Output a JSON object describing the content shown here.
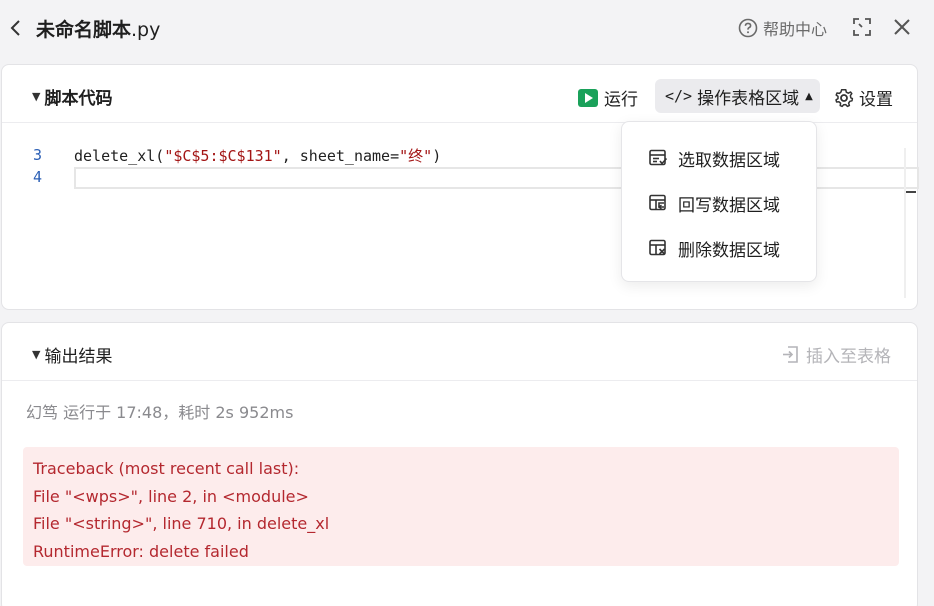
{
  "header": {
    "title": "未命名脚本",
    "title_ext": ".py",
    "help_label": "帮助中心"
  },
  "code_panel": {
    "title": "脚本代码",
    "run_label": "运行",
    "ops_label": "操作表格区域",
    "settings_label": "设置",
    "lines": [
      {
        "num": "3",
        "func": "delete_xl(",
        "arg1": "\"$C$5:$C$131\"",
        "mid": ", sheet_name=",
        "arg2": "\"终\"",
        "end": ")"
      },
      {
        "num": "4"
      }
    ]
  },
  "dropdown": {
    "items": [
      "选取数据区域",
      "回写数据区域",
      "删除数据区域"
    ]
  },
  "output_panel": {
    "title": "输出结果",
    "insert_label": "插入至表格",
    "meta": "幻笃 运行于 17:48，耗时 2s 952ms",
    "error_lines": [
      "Traceback (most recent call last):",
      "File \"<wps>\", line 2, in <module>",
      "File \"<string>\", line 710, in delete_xl",
      "RuntimeError: delete failed"
    ]
  },
  "colors": {
    "run_green": "#1aa15a",
    "error_bg": "#fdecec",
    "error_text": "#b4282f"
  }
}
